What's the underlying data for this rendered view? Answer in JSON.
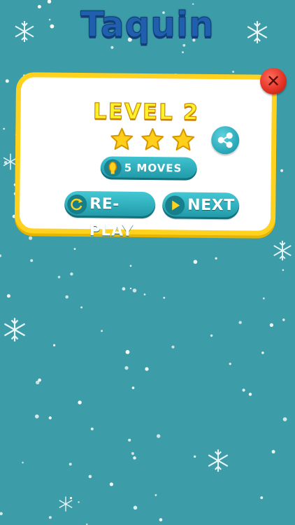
{
  "app": {
    "title": "Taquin"
  },
  "dialog": {
    "level_label": "LEVEL 2",
    "stars_earned": 3,
    "stars_total": 3,
    "moves_label": "5 MOVES",
    "replay_label": "RE-PLAY",
    "next_label": "NEXT",
    "close_symbol": "✕"
  },
  "colors": {
    "background": "#3c9ca7",
    "panel_border": "#ffd21f",
    "button": "#2aa8b6",
    "title": "#1f5fae",
    "level_text": "#fff22a",
    "star": "#ffcf1a",
    "close_button": "#e33527"
  },
  "icons": {
    "close": "close-icon",
    "share": "share-icon",
    "moves": "medal-icon",
    "replay": "replay-icon",
    "next": "play-icon",
    "star": "star-icon",
    "snowflake": "snowflake-icon"
  }
}
